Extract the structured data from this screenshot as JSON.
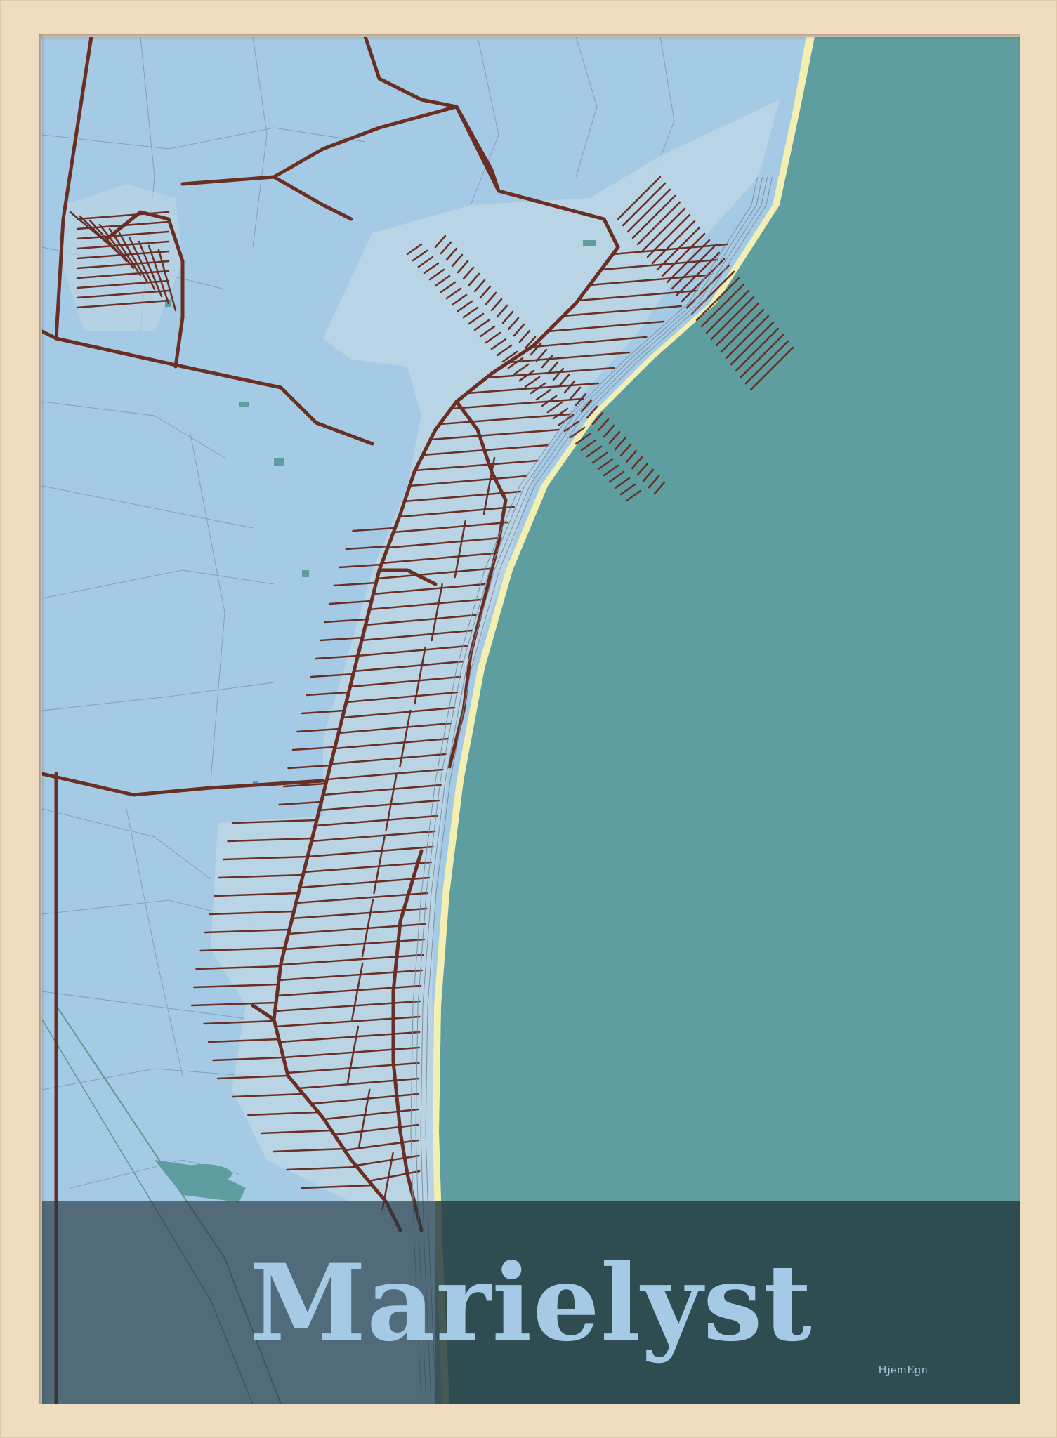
{
  "poster": {
    "title": "Marielyst",
    "brand": "HjemEgn"
  },
  "colors": {
    "frame": "#f0dcc0",
    "land": "#a5cae6",
    "town": "#bcd6e4",
    "sea": "#5e9ea0",
    "beach": "#f3efb0",
    "roads": "#6b2e22",
    "title_band": "#2e4e55",
    "title_text": "#a5cae6"
  }
}
